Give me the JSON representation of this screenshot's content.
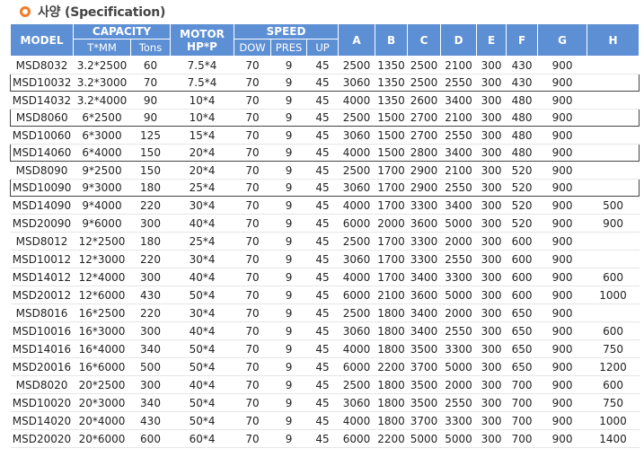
{
  "title": "사양 (Specification)",
  "header": {
    "model": "MODEL",
    "capacity": "CAPACITY",
    "motor": "MOTOR HP*P",
    "speed": "SPEED",
    "tmm": "T*MM",
    "tons": "Tons",
    "dow": "DOW",
    "pres": "PRES",
    "up": "UP",
    "a": "A",
    "b": "B",
    "c": "C",
    "d": "D",
    "e": "E",
    "f": "F",
    "g": "G",
    "h": "H"
  },
  "rows": [
    [
      "MSD8032",
      "3.2*2500",
      "60",
      "7.5*4",
      "70",
      "9",
      "45",
      "2500",
      "1350",
      "2500",
      "2100",
      "300",
      "430",
      "900",
      ""
    ],
    [
      "MSD10032",
      "3.2*3000",
      "70",
      "7.5*4",
      "70",
      "9",
      "45",
      "3060",
      "1350",
      "2500",
      "2550",
      "300",
      "430",
      "900",
      ""
    ],
    [
      "MSD14032",
      "3.2*4000",
      "90",
      "10*4",
      "70",
      "9",
      "45",
      "4000",
      "1350",
      "2600",
      "3400",
      "300",
      "480",
      "900",
      ""
    ],
    [
      "MSD8060",
      "6*2500",
      "90",
      "10*4",
      "70",
      "9",
      "45",
      "2500",
      "1500",
      "2700",
      "2100",
      "300",
      "480",
      "900",
      ""
    ],
    [
      "MSD10060",
      "6*3000",
      "125",
      "15*4",
      "70",
      "9",
      "45",
      "3060",
      "1500",
      "2700",
      "2550",
      "300",
      "480",
      "900",
      ""
    ],
    [
      "MSD14060",
      "6*4000",
      "150",
      "20*4",
      "70",
      "9",
      "45",
      "4000",
      "1500",
      "2800",
      "3400",
      "300",
      "480",
      "900",
      ""
    ],
    [
      "MSD8090",
      "9*2500",
      "150",
      "20*4",
      "70",
      "9",
      "45",
      "2500",
      "1700",
      "2900",
      "2100",
      "300",
      "520",
      "900",
      ""
    ],
    [
      "MSD10090",
      "9*3000",
      "180",
      "25*4",
      "70",
      "9",
      "45",
      "3060",
      "1700",
      "2900",
      "2550",
      "300",
      "520",
      "900",
      ""
    ],
    [
      "MSD14090",
      "9*4000",
      "220",
      "30*4",
      "70",
      "9",
      "45",
      "4000",
      "1700",
      "3300",
      "3400",
      "300",
      "520",
      "900",
      "500"
    ],
    [
      "MSD20090",
      "9*6000",
      "300",
      "40*4",
      "70",
      "9",
      "45",
      "6000",
      "2000",
      "3600",
      "5000",
      "300",
      "520",
      "900",
      "900"
    ],
    [
      "MSD8012",
      "12*2500",
      "180",
      "25*4",
      "70",
      "9",
      "45",
      "2500",
      "1700",
      "3300",
      "2000",
      "300",
      "600",
      "900",
      ""
    ],
    [
      "MSD10012",
      "12*3000",
      "220",
      "30*4",
      "70",
      "9",
      "45",
      "3060",
      "1700",
      "3300",
      "2550",
      "300",
      "600",
      "900",
      ""
    ],
    [
      "MSD14012",
      "12*4000",
      "300",
      "40*4",
      "70",
      "9",
      "45",
      "4000",
      "1700",
      "3400",
      "3300",
      "300",
      "600",
      "900",
      "600"
    ],
    [
      "MSD20012",
      "12*6000",
      "430",
      "50*4",
      "70",
      "9",
      "45",
      "6000",
      "2100",
      "3600",
      "5000",
      "300",
      "600",
      "900",
      "1000"
    ],
    [
      "MSD8016",
      "16*2500",
      "220",
      "30*4",
      "70",
      "9",
      "45",
      "2500",
      "1800",
      "3400",
      "2000",
      "300",
      "650",
      "900",
      ""
    ],
    [
      "MSD10016",
      "16*3000",
      "300",
      "40*4",
      "70",
      "9",
      "45",
      "3060",
      "1800",
      "3400",
      "2550",
      "300",
      "650",
      "900",
      "600"
    ],
    [
      "MSD14016",
      "16*4000",
      "340",
      "50*4",
      "70",
      "9",
      "45",
      "4000",
      "1800",
      "3500",
      "3300",
      "300",
      "650",
      "900",
      "750"
    ],
    [
      "MSD20016",
      "16*6000",
      "500",
      "50*4",
      "70",
      "9",
      "45",
      "6000",
      "2200",
      "3700",
      "5000",
      "300",
      "650",
      "900",
      "1200"
    ],
    [
      "MSD8020",
      "20*2500",
      "300",
      "40*4",
      "70",
      "9",
      "45",
      "2500",
      "1800",
      "3500",
      "2000",
      "300",
      "700",
      "900",
      "600"
    ],
    [
      "MSD10020",
      "20*3000",
      "340",
      "50*4",
      "70",
      "9",
      "45",
      "3060",
      "1800",
      "3500",
      "2550",
      "300",
      "700",
      "900",
      "750"
    ],
    [
      "MSD14020",
      "20*4000",
      "430",
      "50*4",
      "70",
      "9",
      "45",
      "4000",
      "1800",
      "3700",
      "3300",
      "300",
      "700",
      "900",
      "1000"
    ],
    [
      "MSD20020",
      "20*6000",
      "600",
      "60*4",
      "70",
      "9",
      "45",
      "6000",
      "2200",
      "5000",
      "5000",
      "300",
      "700",
      "900",
      "1400"
    ]
  ],
  "boxed_rows": [
    1,
    3,
    5,
    7
  ],
  "colors": {
    "header_bg": "#5d8fd4",
    "bullet": "#f07c2a",
    "box_border": "#444444"
  }
}
